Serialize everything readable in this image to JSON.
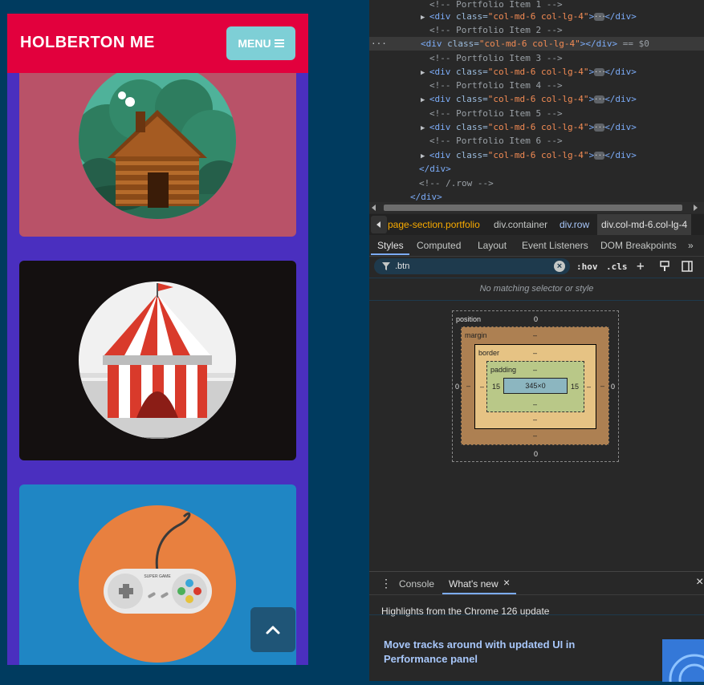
{
  "page": {
    "brand": "HOLBERTON ME",
    "menu_label": "MENU"
  },
  "portfolio": {
    "items": [
      {
        "name": "Cabin",
        "bg": "#b95268"
      },
      {
        "name": "Circus Tent",
        "bg": "#141010"
      },
      {
        "name": "Game Controller",
        "bg": "#1f86c4"
      }
    ],
    "controller_brand": "SUPER GAME"
  },
  "devtools": {
    "dom": [
      {
        "type": "comment",
        "text": "<!-- Portfolio Item 1 -->"
      },
      {
        "type": "element",
        "open": "<div ",
        "attr": "class=",
        "val": "\"col-md-6 col-lg-4\"",
        "close": "</div>",
        "ellipsis": true
      },
      {
        "type": "comment",
        "text": "<!-- Portfolio Item 2 -->"
      },
      {
        "type": "element",
        "open": "<div ",
        "attr": "class=",
        "val": "\"col-md-6 col-lg-4\"",
        "close": "></div>",
        "ellipsis": false,
        "suffix": " == $0"
      },
      {
        "type": "comment",
        "text": "<!-- Portfolio Item 3 -->"
      },
      {
        "type": "element",
        "open": "<div ",
        "attr": "class=",
        "val": "\"col-md-6 col-lg-4\"",
        "close": "</div>",
        "ellipsis": true
      },
      {
        "type": "comment",
        "text": "<!-- Portfolio Item 4 -->"
      },
      {
        "type": "element",
        "open": "<div ",
        "attr": "class=",
        "val": "\"col-md-6 col-lg-4\"",
        "close": "</div>",
        "ellipsis": true
      },
      {
        "type": "comment",
        "text": "<!-- Portfolio Item 5 -->"
      },
      {
        "type": "element",
        "open": "<div ",
        "attr": "class=",
        "val": "\"col-md-6 col-lg-4\"",
        "close": "</div>",
        "ellipsis": true
      },
      {
        "type": "comment",
        "text": "<!-- Portfolio Item 6 -->"
      },
      {
        "type": "element",
        "open": "<div ",
        "attr": "class=",
        "val": "\"col-md-6 col-lg-4\"",
        "close": "</div>",
        "ellipsis": true
      },
      {
        "type": "closetag",
        "text": "</div>"
      },
      {
        "type": "comment",
        "text": "<!-- /.row -->"
      },
      {
        "type": "closetag",
        "text": "</div>"
      }
    ],
    "breadcrumbs": [
      "page-section.portfolio",
      "div.container",
      "div.row",
      "div.col-md-6.col-lg-4"
    ],
    "tabs": [
      "Styles",
      "Computed",
      "Layout",
      "Event Listeners",
      "DOM Breakpoints"
    ],
    "filter_value": ".btn",
    "hov": ":hov",
    "cls": ".cls",
    "no_match": "No matching selector or style",
    "box_model": {
      "position_label": "position",
      "margin_label": "margin",
      "border_label": "border",
      "padding_label": "padding",
      "position_top": "0",
      "position_bottom": "0",
      "position_left": "0",
      "position_right": "0",
      "margin_top": "–",
      "margin_bottom": "–",
      "margin_left": "–",
      "margin_right": "–",
      "border_top": "–",
      "border_bottom": "–",
      "border_left": "–",
      "border_right": "–",
      "padding_top": "–",
      "padding_bottom": "–",
      "padding_left": "15",
      "padding_right": "15",
      "content": "345×0"
    },
    "drawer": {
      "tabs": [
        "Console",
        "What's new"
      ],
      "headline": "Highlights from the Chrome 126 update",
      "article_title": "Move tracks around with updated UI in Performance panel"
    }
  }
}
